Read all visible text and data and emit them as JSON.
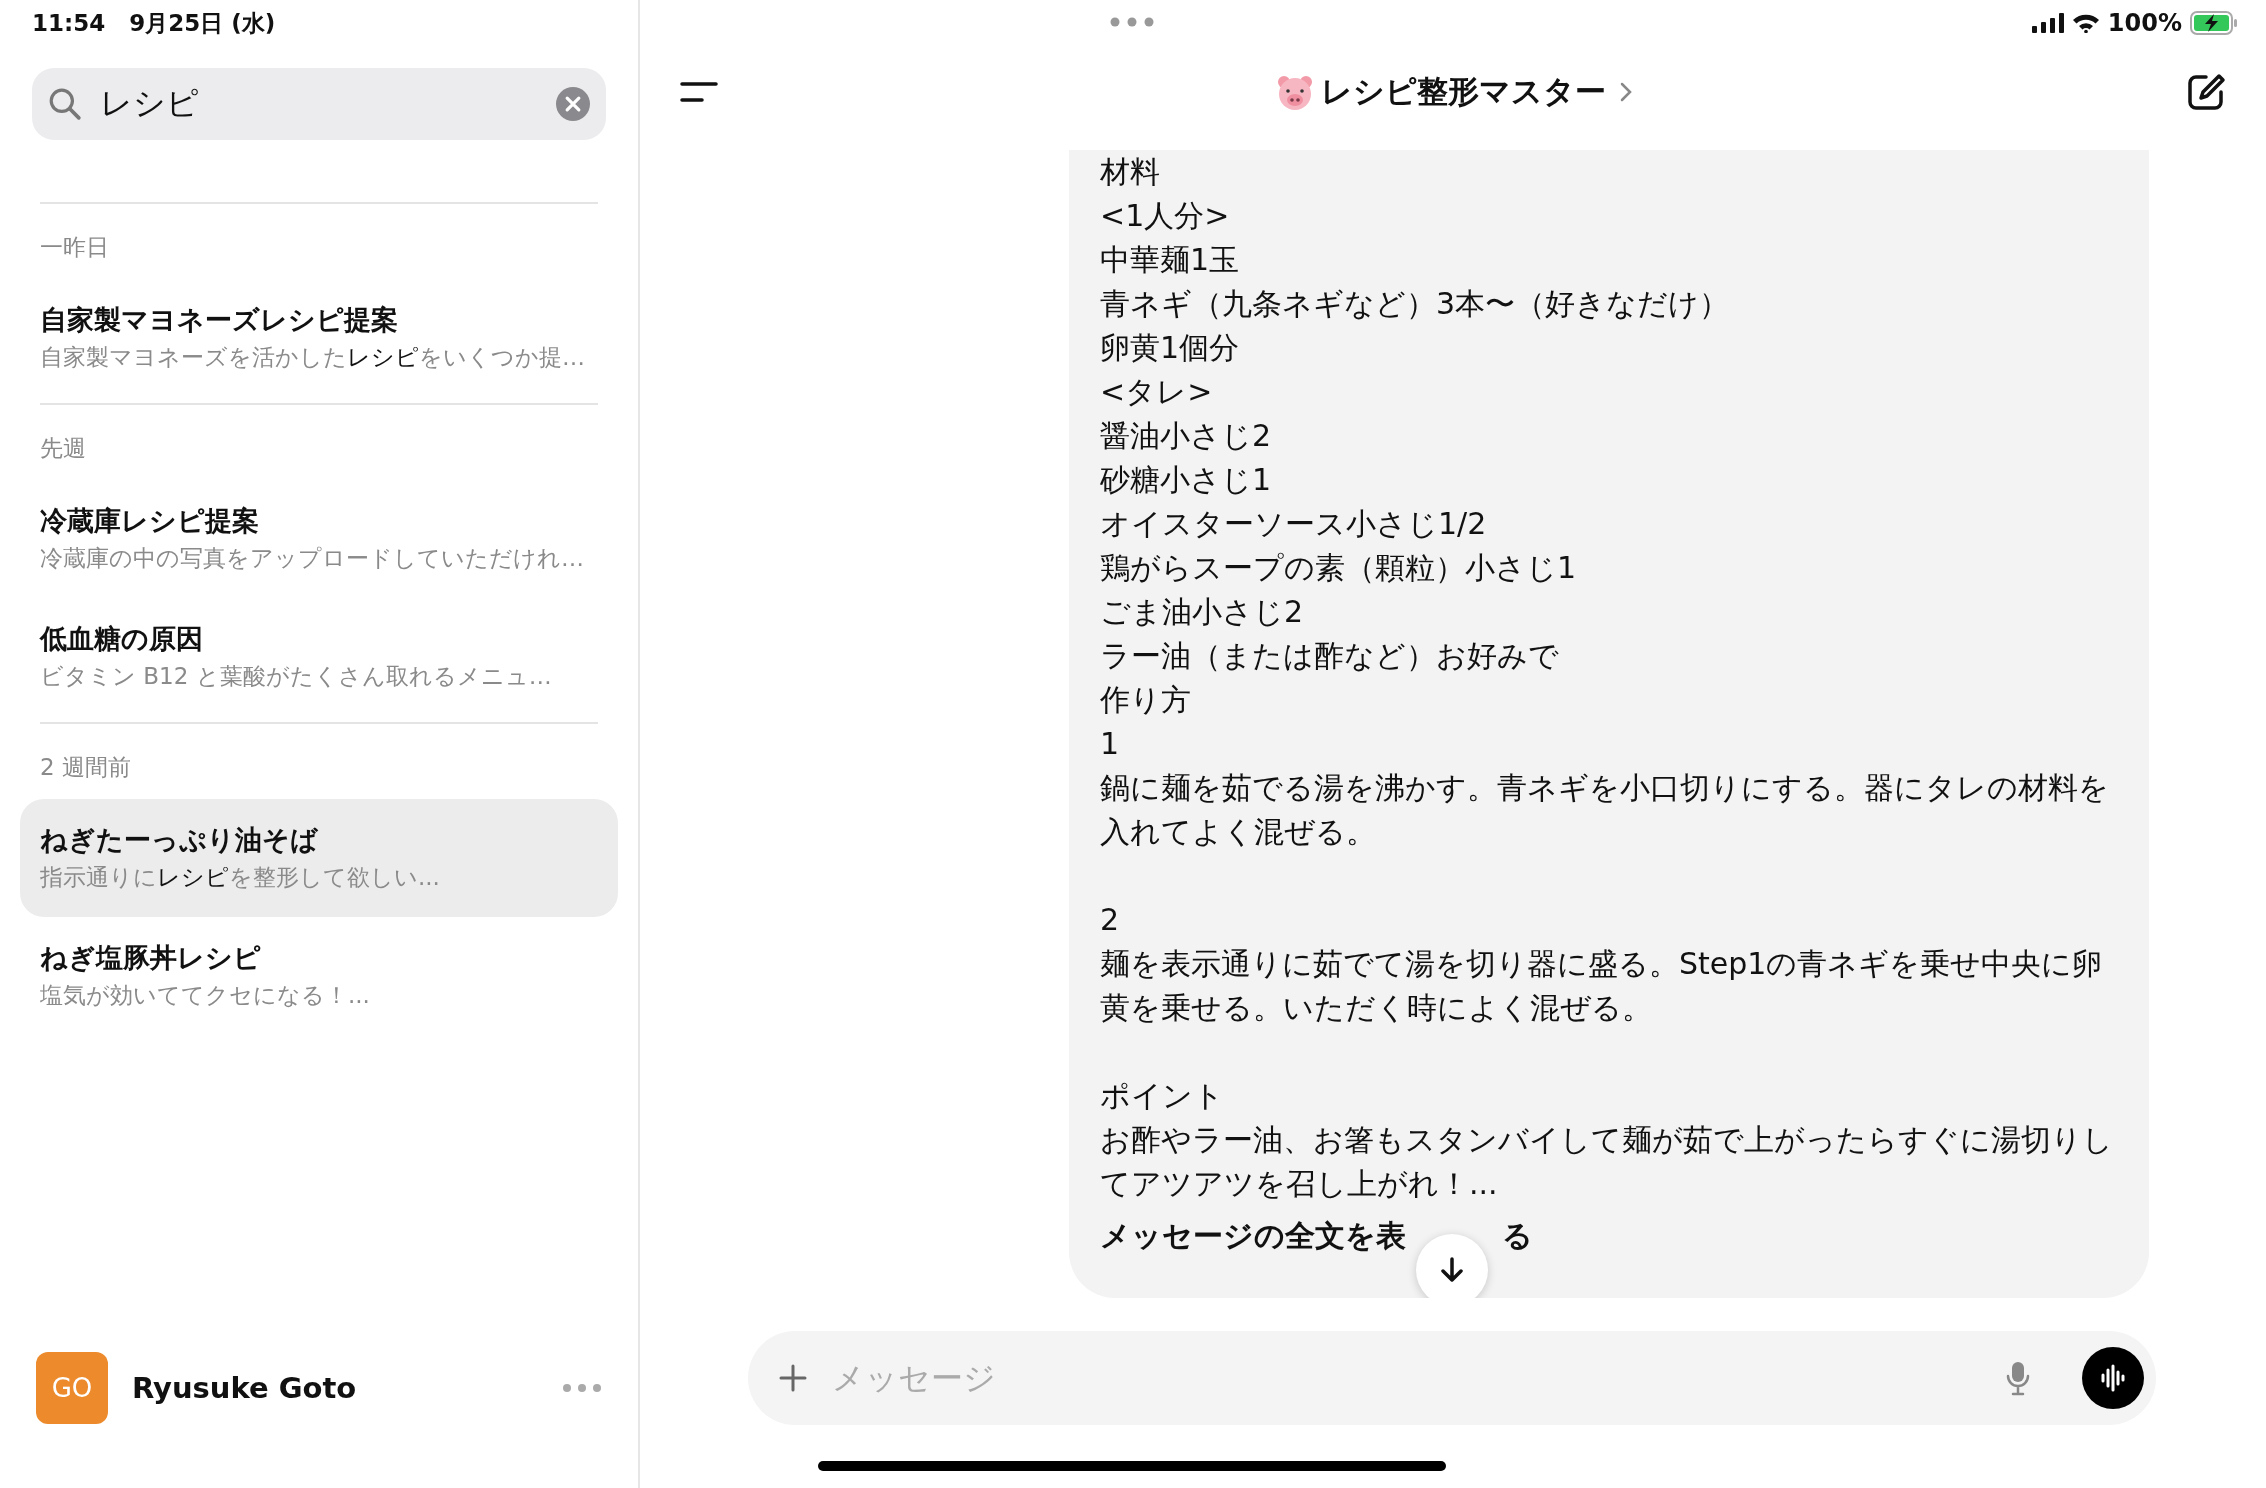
{
  "status_bar": {
    "time": "11:54",
    "date": "9月25日 (水)",
    "battery": "100%"
  },
  "search": {
    "value": "レシピ"
  },
  "sidebar": {
    "sections": [
      {
        "heading": "一昨日",
        "items": [
          {
            "title": "自家製マヨネーズレシピ提案",
            "preview": "自家製マヨネーズを活かした**レシピ**をいくつか提…",
            "selected": false
          }
        ]
      },
      {
        "heading": "先週",
        "items": [
          {
            "title": "冷蔵庫レシピ提案",
            "preview": "冷蔵庫の中の写真をアップロードしていただけれ…",
            "selected": false
          },
          {
            "title": "低血糖の原因",
            "preview": "ビタミン B12 と葉酸がたくさん取れるメニュ…",
            "selected": false
          }
        ]
      },
      {
        "heading": "2 週間前",
        "items": [
          {
            "title": "ねぎたーっぷり油そば",
            "preview": "指示通りに**レシピ**を整形して欲しい...",
            "selected": true
          },
          {
            "title": "ねぎ塩豚丼レシピ",
            "preview": "塩気が効いててクセになる！...",
            "selected": false
          }
        ]
      }
    ]
  },
  "user": {
    "initials": "GO",
    "name": "Ryusuke Goto"
  },
  "chat": {
    "title": "レシピ整形マスター",
    "message": {
      "groups": [
        [
          "材料",
          "<1人分>",
          "中華麺1玉",
          "青ネギ（九条ネギなど）3本〜（好きなだけ）",
          "卵黄1個分",
          "<タレ>",
          "醤油小さじ2",
          "砂糖小さじ1",
          "オイスターソース小さじ1/2",
          "鶏がらスープの素（顆粒）小さじ1",
          "ごま油小さじ2",
          "ラー油（または酢など）お好みで",
          "作り方",
          "1",
          "鍋に麺を茹でる湯を沸かす。青ネギを小口切りにする。器にタレの材料を入れてよく混ぜる。"
        ],
        [
          "2",
          "麺を表示通りに茹でて湯を切り器に盛る。Step1の青ネギを乗せ中央に卵黄を乗せる。いただく時によく混ぜる。"
        ],
        [
          "ポイント",
          "お酢やラー油、お箸もスタンバイして麺が茹で上がったらすぐに湯切りしてアツアツを召し上がれ！..."
        ]
      ],
      "show_full": [
        "メッセージの全文を表",
        "る"
      ]
    },
    "input": {
      "placeholder": "メッセージ"
    }
  }
}
